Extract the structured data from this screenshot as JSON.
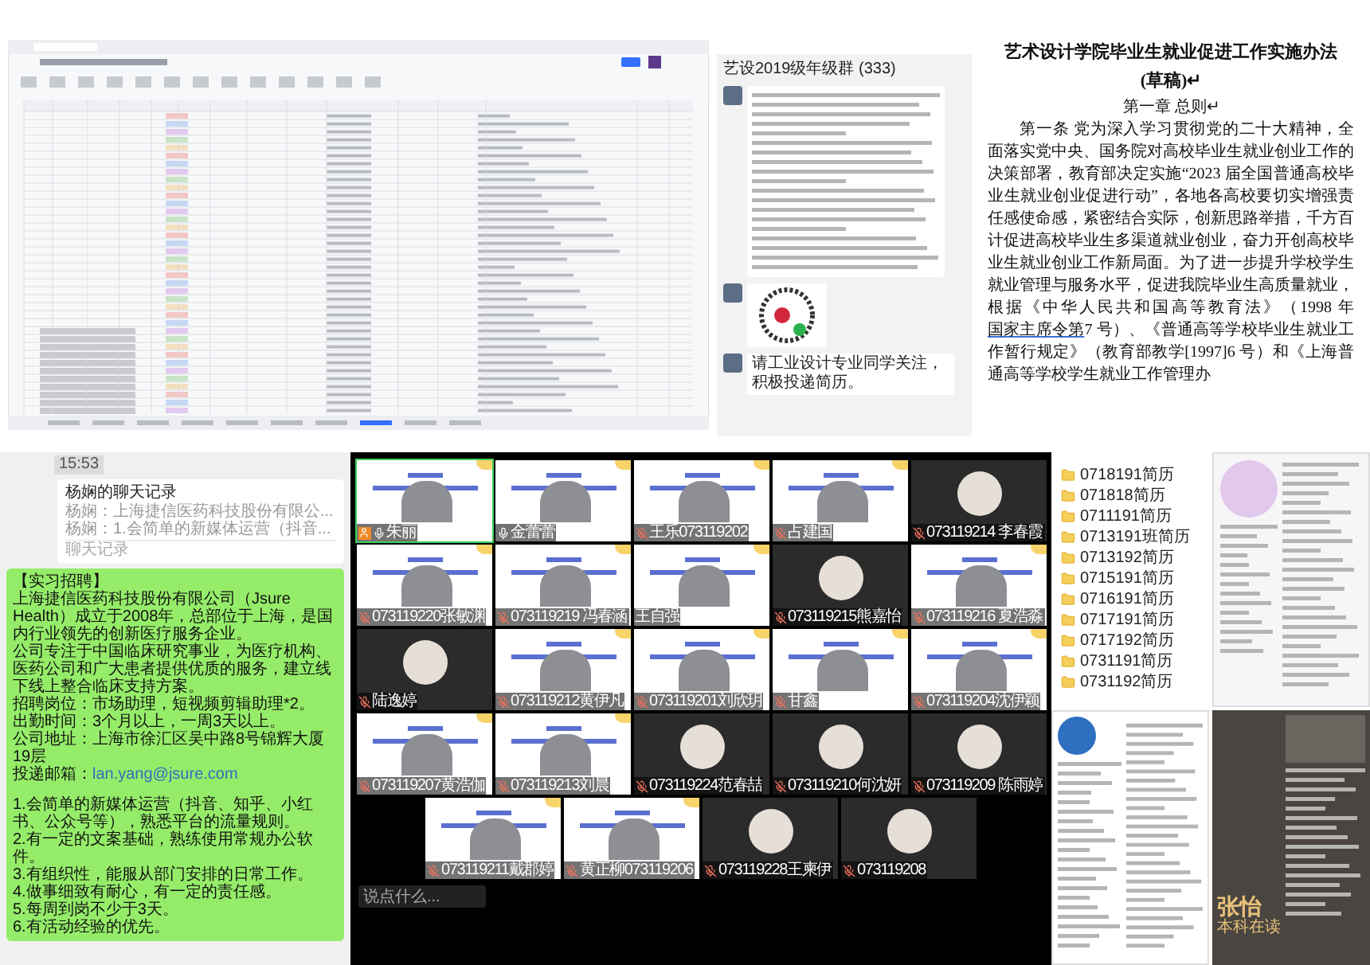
{
  "group_chat": {
    "title": "艺设2019级年级群 (333)",
    "last_message": "请工业设计专业同学关注，积极投递简历。"
  },
  "document": {
    "title": "艺术设计学院毕业生就业促进工作实施办法",
    "subtitle": "(草稿)↵",
    "chapter": "第一章 总则↵",
    "text_before": "第一条 党为深入学习贯彻党的二十大精神，全面落实党中央、国务院对高校毕业生就业创业工作的决策部署，教育部决定实施“2023 届全国普通高校毕业生就业创业促进行动”，各地各高校要切实增强责任感使命感，紧密结合实际，创新思路举措，千方百计促进高校毕业生多渠道就业创业，奋力开创高校毕业生就业创业工作新局面。为了进一步提升学校学生就业管理与服务水平，促进我院毕业生高质量就业，根据《中华人民共和国高等教育法》（1998 年",
    "link": "国家主席令第",
    "text_after": "7 号）、《普通高等学校毕业生就业工作暂行规定》（教育部教学[1997]6 号）和《上海普通高等学校学生就业工作管理办"
  },
  "chat_record": {
    "time": "15:53",
    "card": {
      "title": "杨娴的聊天记录",
      "lines": [
        "杨娴：上海捷信医药科技股份有限公...",
        "杨娴：1.会简单的新媒体运营（抖音..."
      ],
      "footer": "聊天记录"
    },
    "message": {
      "lines": [
        "【实习招聘】",
        "上海捷信医药科技股份有限公司（Jsure Health）成立于2008年，总部位于上海，是国内行业领先的创新医疗服务企业。",
        "公司专注于中国临床研究事业，为医疗机构、医药公司和广大患者提供优质的服务，建立线下线上整合临床支持方案。",
        "招聘岗位：市场助理，短视频剪辑助理*2。",
        "出勤时间：3个月以上，一周3天以上。",
        "公司地址：上海市徐汇区吴中路8号锦辉大厦19层"
      ],
      "email_label": "投递邮箱：",
      "email": "lan.yang@jsure.com",
      "requirements": [
        "1.会简单的新媒体运营（抖音、知乎、小红书、公众号等），熟悉平台的流量规则。",
        "2.有一定的文案基础，熟练使用常规办公软件。",
        "3.有组织性，能服从部门安排的日常工作。",
        "4.做事细致有耐心，有一定的责任感。",
        "5.每周到岗不少于3天。",
        "6.有活动经验的优先。"
      ]
    }
  },
  "meeting": {
    "tiles": [
      {
        "name": "朱丽",
        "kind": "slide",
        "muted": false,
        "active": true,
        "host": true
      },
      {
        "name": "金蕾蕾",
        "kind": "slide",
        "muted": false,
        "active": false,
        "host": false
      },
      {
        "name": "王乐073119202",
        "kind": "slide",
        "muted": true,
        "active": false,
        "host": false
      },
      {
        "name": "占建国",
        "kind": "slide",
        "muted": true,
        "active": false,
        "host": false
      },
      {
        "name": "073119214 李春霞",
        "kind": "avatar",
        "muted": true,
        "active": false,
        "host": false
      },
      {
        "name": "073119220张敏渊",
        "kind": "slide",
        "muted": true,
        "active": false,
        "host": false
      },
      {
        "name": "073119219 冯春涵",
        "kind": "slide",
        "muted": true,
        "active": false,
        "host": false
      },
      {
        "name": "王自强",
        "kind": "slide",
        "active": false,
        "host": false
      },
      {
        "name": "073119215熊嘉怡",
        "kind": "avatar",
        "muted": true,
        "active": false,
        "host": false
      },
      {
        "name": "073119216 夏浩淼",
        "kind": "slide",
        "muted": true,
        "active": false,
        "host": false
      },
      {
        "name": "陆逸婷",
        "kind": "avatar",
        "muted": true,
        "active": false,
        "host": false
      },
      {
        "name": "073119212黄伊凡",
        "kind": "slide",
        "muted": true,
        "active": false,
        "host": false
      },
      {
        "name": "073119201刘欣玥",
        "kind": "slide",
        "muted": true,
        "active": false,
        "host": false
      },
      {
        "name": "甘鑫",
        "kind": "slide",
        "muted": true,
        "active": false,
        "host": false
      },
      {
        "name": "073119204沈伊颖",
        "kind": "slide",
        "muted": true,
        "active": false,
        "host": false
      },
      {
        "name": "073119207黄浩伽",
        "kind": "slide",
        "muted": true,
        "active": false,
        "host": false
      },
      {
        "name": "073119213刘晨",
        "kind": "slide",
        "muted": true,
        "active": false,
        "host": false
      },
      {
        "name": "073119224范春喆",
        "kind": "avatar",
        "muted": true,
        "active": false,
        "host": false
      },
      {
        "name": "073119210何沈妍",
        "kind": "avatar",
        "muted": true,
        "active": false,
        "host": false
      },
      {
        "name": "073119209 陈雨婷",
        "kind": "avatar",
        "muted": true,
        "active": false,
        "host": false
      },
      {
        "name": "073119211戴郡婷",
        "kind": "slide",
        "muted": true,
        "active": false,
        "host": false
      },
      {
        "name": "黄正柳073119206",
        "kind": "slide",
        "muted": true,
        "active": false,
        "host": false
      },
      {
        "name": "073119228王柬伊",
        "kind": "avatar",
        "muted": true,
        "active": false,
        "host": false
      },
      {
        "name": "073119208",
        "kind": "avatar",
        "muted": true,
        "active": false,
        "host": false
      }
    ],
    "comment_placeholder": "说点什么..."
  },
  "folders": [
    "0718191简历",
    "071818简历",
    "0711191简历",
    "0713191班简历",
    "0713192简历",
    "0715191简历",
    "0716191简历",
    "0717191简历",
    "0717192简历",
    "0731191简历",
    "0731192简历"
  ],
  "resume": {
    "name": "张怡",
    "subtitle": "本科在读"
  }
}
